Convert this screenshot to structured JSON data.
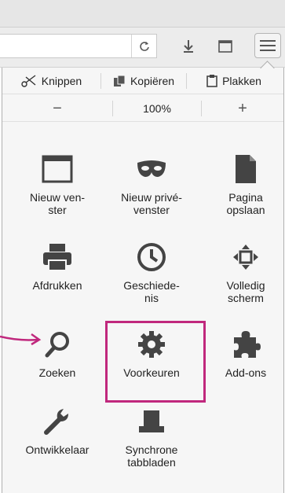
{
  "editbar": {
    "cut": "Knippen",
    "copy": "Kopiëren",
    "paste": "Plakken"
  },
  "zoom": {
    "minus": "−",
    "level": "100%",
    "plus": "+"
  },
  "grid": [
    {
      "label": "Nieuw ven-\nster",
      "icon": "new-window-icon"
    },
    {
      "label": "Nieuw privé-\nvenster",
      "icon": "private-mask-icon"
    },
    {
      "label": "Pagina\nopslaan",
      "icon": "save-page-icon"
    },
    {
      "label": "Afdrukken",
      "icon": "printer-icon"
    },
    {
      "label": "Geschiede-\nnis",
      "icon": "history-clock-icon"
    },
    {
      "label": "Volledig\nscherm",
      "icon": "fullscreen-icon"
    },
    {
      "label": "Zoeken",
      "icon": "search-icon"
    },
    {
      "label": "Voorkeuren",
      "icon": "gear-icon"
    },
    {
      "label": "Add-ons",
      "icon": "puzzle-icon"
    },
    {
      "label": "Ontwikkelaar",
      "icon": "wrench-icon"
    },
    {
      "label": "Synchrone\ntabbladen",
      "icon": "synced-tabs-icon"
    }
  ],
  "colors": {
    "highlight": "#c0287d",
    "icon": "#444444"
  }
}
